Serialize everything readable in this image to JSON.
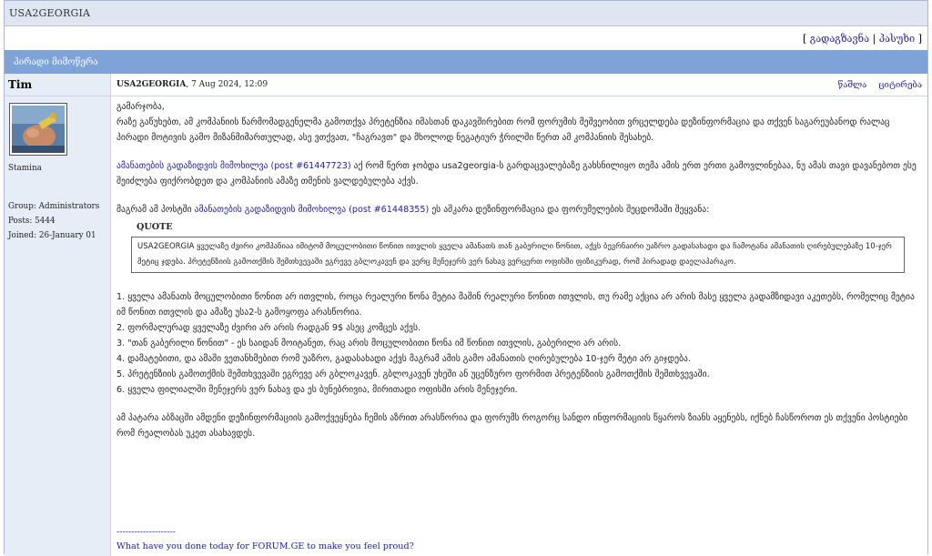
{
  "forum": {
    "title": "USA2GEORGIA"
  },
  "actions": {
    "open": "[",
    "forward": "გადაგზავნა",
    "sep": "|",
    "reply": "პასუხი",
    "close": "]"
  },
  "section": {
    "title": "პირადი მიმოწერა"
  },
  "author": {
    "name": "Tim",
    "title": "Stamina",
    "group": "Group: Administrators",
    "posts": "Posts: 5444",
    "joined": "Joined: 26-January 01"
  },
  "meta": {
    "poster": "USA2GEORGIA",
    "date": ", 7 Aug 2024, 12:09",
    "delete": "წაშლა",
    "quote": "ციტირება"
  },
  "body": {
    "greeting": "გამარჯობა,",
    "p1": "რაზე გაწუხებთ, ამ კომპანიის წარმომადგენელმა გამოთქვა პრეტენზია იმასთან დაკავშირებით რომ ფორუმის მეშვეობით ვრცელდება დეზინფორმაცია და თქვენ საგარეუბანოდ რალაც პირადი მოტივის გამო მიზანმიმართულად, ასე ვთქვათ, \"ჩაგრავთ\" და მხოლოდ ნეგატიურ ჭრილში წერთ ამ კომპანიის შესახებ.",
    "p2_link": "ამანათების გადაზიდვის მიმოხილვა (post #61447723)",
    "p2_rest": " აქ რომ წერთ ჯობდა usa2georgia-ს გარდაცვალებაზე გახსნილიყო თემა ამის ერთ ერთი გამოვლინებაა, ნუ ამას თავი დავანებოთ ესე შეიძლება ფიქრობდეთ და კომპანიის ამაზე თმენის ვალდებულება აქვს.",
    "p3_pre": "მაგრამ ამ პოსტში ",
    "p3_link": "ამანათების გადაზიდვის მიმოხილვა (post #61448355)",
    "p3_rest": " ეს აშკარა დეზინფორმაცია და ფორუმელების შეცდომაში შეყვანა:",
    "quote_label": "QUOTE",
    "quote_text": "USA2GEORGIA ყველაზე ძვირი კომპანიაა იმიტომ მოცულობითი წონით ითვლის ყველა ამანათს თან გაბერილი წონით, აქვს ბევრნაირი უაზრო გადასახადი და ჩამოტანა ამანათის ღირებულებაზე 10-ჯერ მეტიც ჯდება. პრეტენზიის გამოთქმის შემთხვევაში ეგრევე გბლოკავენ და ვერც მენეჯერს ვერ ნახავ ვერცერთ ოფისში ფიზიკურად, რომ პირადად დაელაპარაკო.",
    "list": [
      "1. ყველა ამანათს მოცულობითი წონით არ ითვლის, როცა რეალური წონა მეტია მაშინ რეალური წონით ითვლის, თუ რამე აქცია არ არის მასე ყველა გადამზიდავი აკეთებს, რომელიც მეტია იმ წონით ითვლის და ამაზე უსა2-ს გამოყოფა არასწორია.",
      "2. ფორმალურად ყველაზე ძვირი არ არის რადგან 9$ ასეც კომცეს აქვს.",
      "3. \"თან გაბერილი წონით\" - ეს საიდან მოიტანეთ, რაც არის მოცულობითი წონა იმ წონით ითვლის, გაბერილი არ არის.",
      "4. დამატებითი, და ამაში ვეთანხმებით რომ უაზრო, გადასახადი აქვს მაგრამ ამის გამო ამანათის ღირებულება 10-ჯერ მეტი არ გიჯდება.",
      "5. პრეტენზიის გამოთქმის შემთხვევაში ეგრევე არ გბლოკავენ. გბლოკავენ უხეში ან უცენზურო ფორმით პრეტენზიის გამოთქმის შემთხვევაში.",
      "6. ყველა ფილიალში მენეჯერს ვერ ნახავ და ეს ბუნებრივია, მირითადი ოფისში არის მენეჯერი."
    ],
    "closing": "ამ პატარა აბზაცში ამდენი დეზინფორმაციის გამოქვეყნება ჩემის აზრით არასწორია და ფორუმს როგორც სანდო ინფორმაციის წყაროს ზიანს აყენებს, იქნებ ჩასწოროთ ეს თქვენი პოსტიები რომ რეალობას უკეთ ასახავდეს."
  },
  "signature": {
    "divider": "--------------------",
    "text": "What have you done today for FORUM.GE to make you feel proud?"
  },
  "colors": {
    "topbar": "#dfe6f2",
    "section": "#7ea3d8",
    "sidebar": "#e6edf6",
    "link": "#22229a"
  }
}
